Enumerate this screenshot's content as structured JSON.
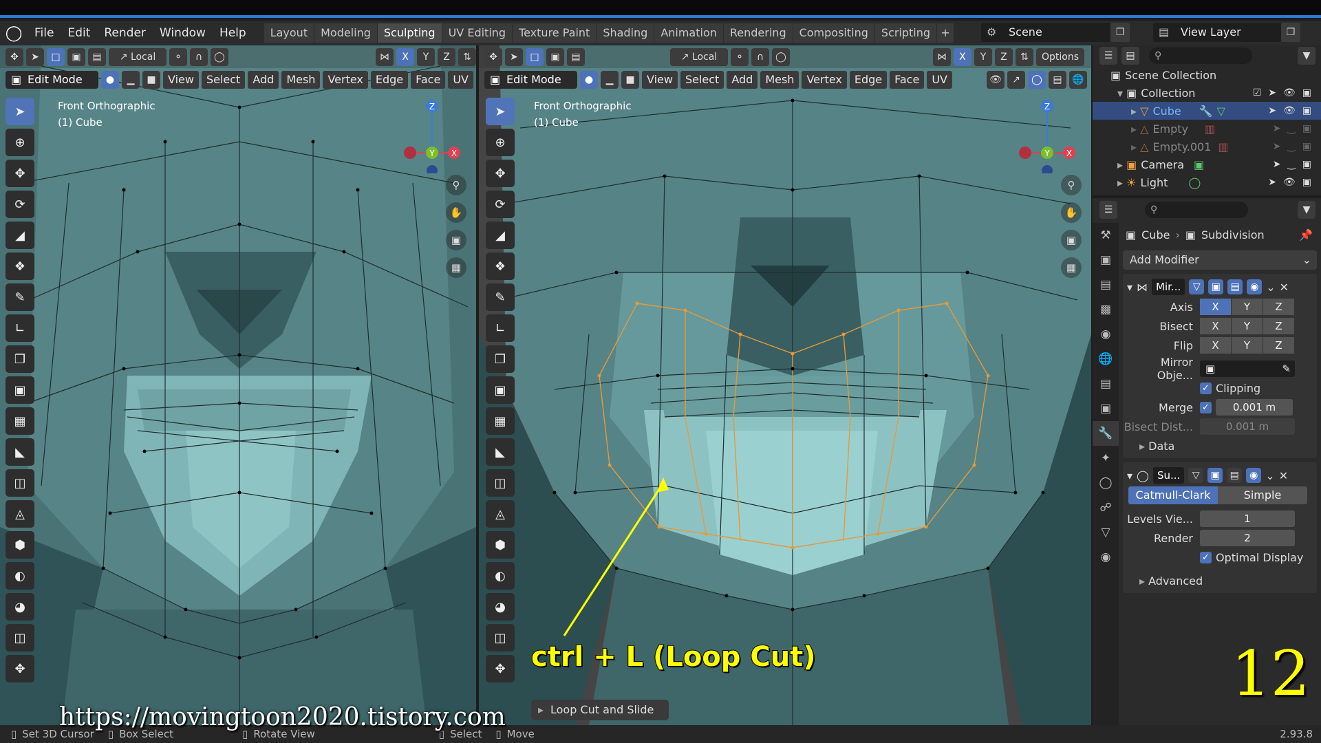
{
  "menubar": {
    "items": [
      "File",
      "Edit",
      "Render",
      "Window",
      "Help"
    ]
  },
  "workspaces": {
    "tabs": [
      "Layout",
      "Modeling",
      "Sculpting",
      "UV Editing",
      "Texture Paint",
      "Shading",
      "Animation",
      "Rendering",
      "Compositing",
      "Scripting"
    ],
    "active": "Sculpting",
    "add": "+"
  },
  "scene": {
    "name": "Scene",
    "view_layer": "View Layer"
  },
  "viewport": {
    "orientation": "Local",
    "mode": "Edit Mode",
    "menus": [
      "View",
      "Select",
      "Add",
      "Mesh",
      "Vertex",
      "Edge",
      "Face",
      "UV"
    ],
    "axes": [
      "X",
      "Y",
      "Z"
    ],
    "options": "Options",
    "label_view": "Front Orthographic",
    "label_obj": "(1) Cube",
    "gizmo": {
      "z": "Z",
      "y": "Y",
      "x": "X"
    }
  },
  "outliner": {
    "root": "Scene Collection",
    "items": [
      {
        "name": "Collection",
        "level": 1
      },
      {
        "name": "Cube",
        "level": 2,
        "selected": true
      },
      {
        "name": "Empty",
        "level": 2,
        "dim": true
      },
      {
        "name": "Empty.001",
        "level": 2,
        "dim": true
      },
      {
        "name": "Camera",
        "level": 1
      },
      {
        "name": "Light",
        "level": 1
      }
    ]
  },
  "properties": {
    "breadcrumb_obj": "Cube",
    "breadcrumb_mod": "Subdivision",
    "add_modifier": "Add Modifier",
    "mirror": {
      "name": "Mir...",
      "axis_label": "Axis",
      "bisect_label": "Bisect",
      "flip_label": "Flip",
      "mirror_obj_label": "Mirror Obje...",
      "clipping": "Clipping",
      "merge_label": "Merge",
      "merge_value": "0.001 m",
      "bisect_dist_label": "Bisect Dist...",
      "bisect_dist_value": "0.001 m",
      "data": "Data"
    },
    "subsurf": {
      "name": "Su...",
      "type_a": "Catmull-Clark",
      "type_b": "Simple",
      "levels_label": "Levels Vie...",
      "levels_value": "1",
      "render_label": "Render",
      "render_value": "2",
      "optimal": "Optimal Display",
      "advanced": "Advanced"
    }
  },
  "overlay": {
    "watermark": "https://movingtoon2020.tistory.com",
    "big_number": "12",
    "caption": "ctrl + L (Loop Cut)",
    "last_op": "Loop Cut and Slide"
  },
  "statusbar": {
    "set_cursor": "Set 3D Cursor",
    "box_select": "Box Select",
    "rotate": "Rotate View",
    "select": "Select",
    "move": "Move",
    "version": "2.93.8"
  },
  "colors": {
    "mesh_face": "#5e8f91",
    "mesh_dark": "#2f5356",
    "mesh_light": "#8fc4c4",
    "loop_edge": "#e59a3a",
    "accent": "#4d72b8"
  }
}
